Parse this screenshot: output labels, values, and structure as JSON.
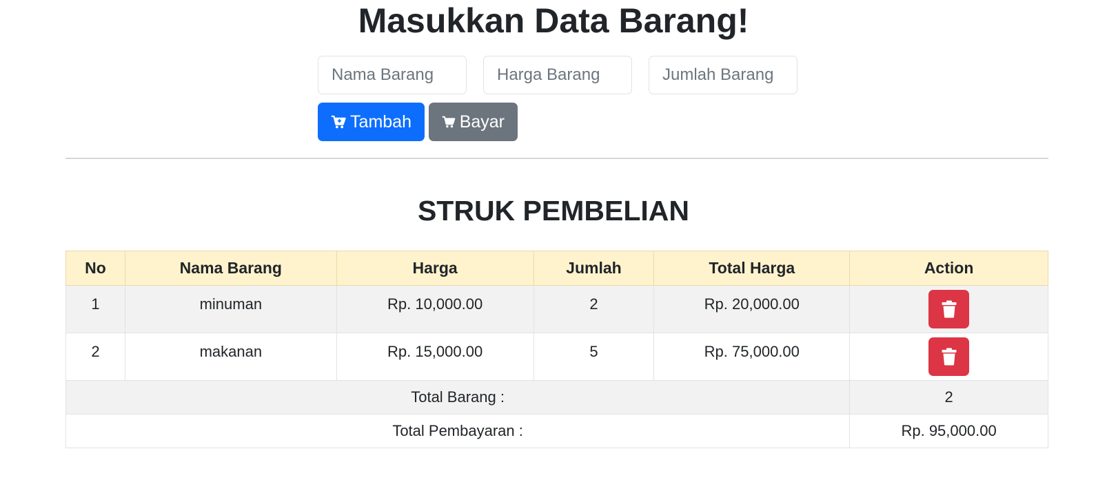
{
  "form": {
    "title": "Masukkan Data Barang!",
    "name_placeholder": "Nama Barang",
    "price_placeholder": "Harga Barang",
    "qty_placeholder": "Jumlah Barang",
    "add_label": "Tambah",
    "pay_label": "Bayar"
  },
  "receipt": {
    "title": "STRUK PEMBELIAN",
    "columns": [
      "No",
      "Nama Barang",
      "Harga",
      "Jumlah",
      "Total Harga",
      "Action"
    ],
    "rows": [
      {
        "no": "1",
        "name": "minuman",
        "price": "Rp. 10,000.00",
        "qty": "2",
        "total": "Rp. 20,000.00"
      },
      {
        "no": "2",
        "name": "makanan",
        "price": "Rp. 15,000.00",
        "qty": "5",
        "total": "Rp. 75,000.00"
      }
    ],
    "total_items_label": "Total Barang :",
    "total_items_value": "2",
    "total_payment_label": "Total Pembayaran :",
    "total_payment_value": "Rp. 95,000.00"
  },
  "colors": {
    "primary": "#0d6efd",
    "secondary": "#6c757d",
    "danger": "#dc3545",
    "header_bg": "#fff3cd"
  }
}
